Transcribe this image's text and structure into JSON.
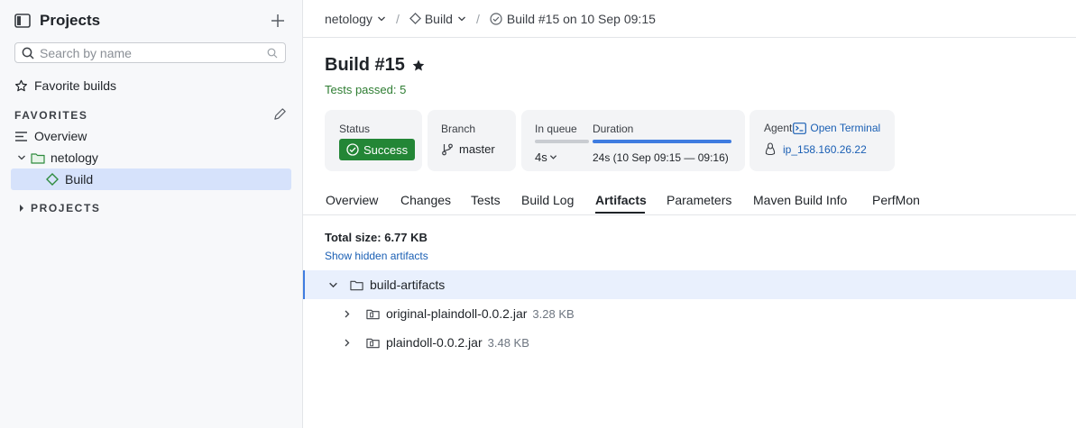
{
  "sidebar": {
    "title": "Projects",
    "search_placeholder": "Search by name",
    "favorite_builds_label": "Favorite builds",
    "favorites_section": "FAVORITES",
    "overview_label": "Overview",
    "project_label": "netology",
    "build_label": "Build",
    "projects_section": "PROJECTS"
  },
  "breadcrumb": {
    "project": "netology",
    "build_config": "Build",
    "build": "Build #15 on 10 Sep 09:15"
  },
  "build": {
    "title": "Build #15",
    "tests_passed": "Tests passed: 5",
    "status_label": "Status",
    "status_value": "Success",
    "branch_label": "Branch",
    "branch_value": "master",
    "in_queue_label": "In queue",
    "in_queue_value": "4s",
    "duration_label": "Duration",
    "duration_value": "24s (10 Sep 09:15 — 09:16)",
    "duration_progress": 1.0,
    "agent_label": "Agent",
    "open_terminal": "Open Terminal",
    "agent_value": "ip_158.160.26.22"
  },
  "tabs": [
    "Overview",
    "Changes",
    "Tests",
    "Build Log",
    "Artifacts",
    "Parameters",
    "Maven Build Info",
    "PerfMon"
  ],
  "active_tab": "Artifacts",
  "artifacts": {
    "total_size": "Total size: 6.77 KB",
    "show_hidden": "Show hidden artifacts",
    "folder": "build-artifacts",
    "files": [
      {
        "name": "original-plaindoll-0.0.2.jar",
        "size": "3.28 KB"
      },
      {
        "name": "plaindoll-0.0.2.jar",
        "size": "3.48 KB"
      }
    ]
  },
  "colors": {
    "success": "#238636",
    "link": "#1a5fb4",
    "selected": "#d6e2fb",
    "tests_passed": "#2e7d32"
  }
}
